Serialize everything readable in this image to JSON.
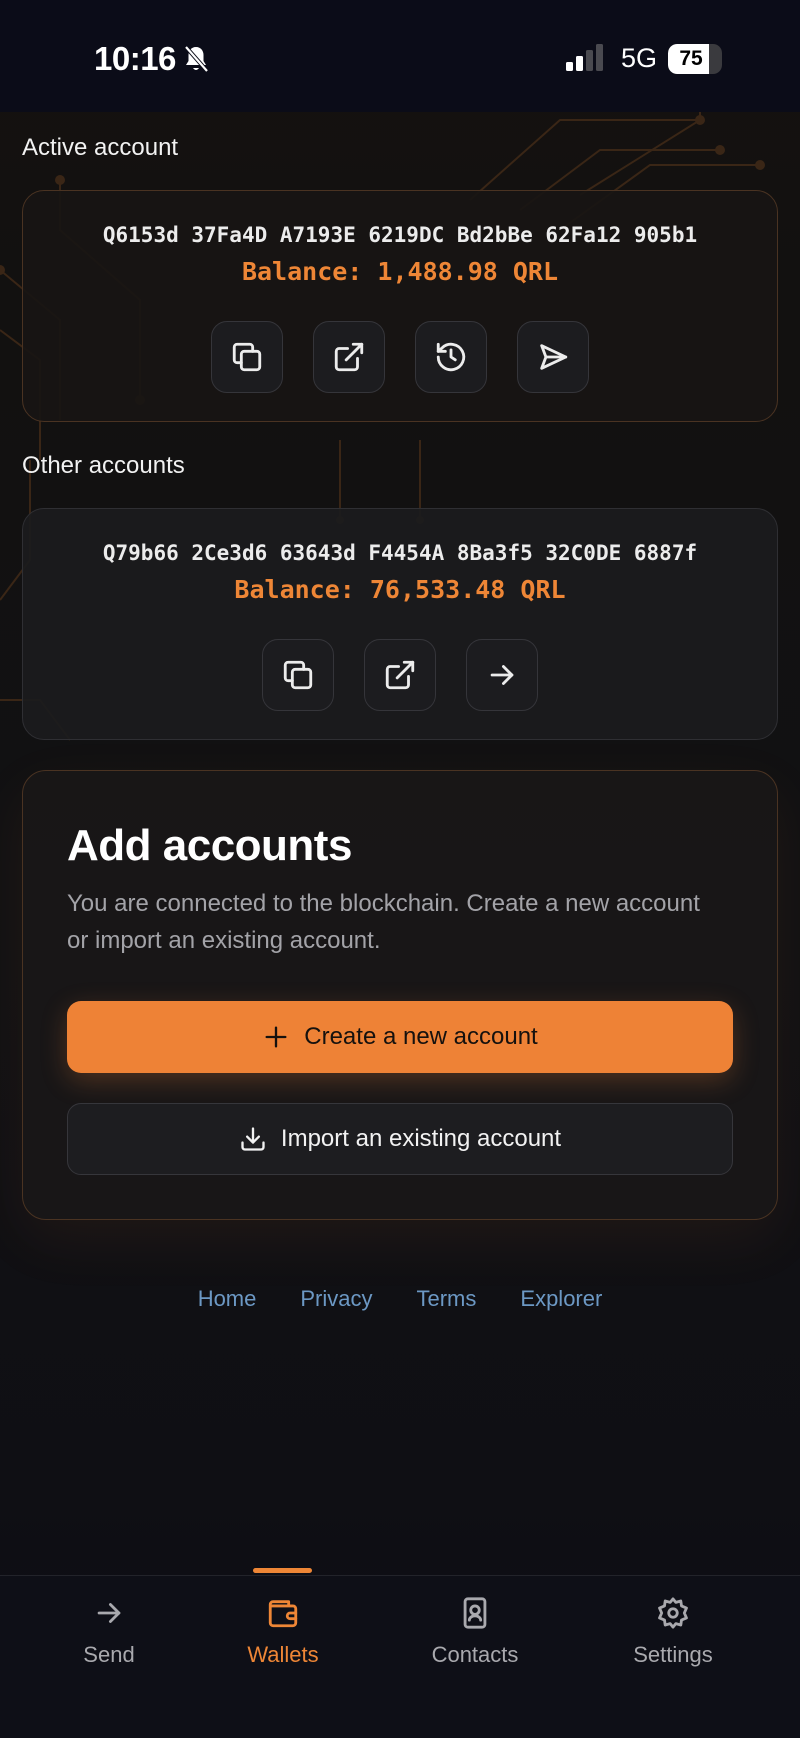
{
  "status_bar": {
    "time": "10:16",
    "network": "5G",
    "battery_percent": 75,
    "battery_label": "75",
    "signal_bars_active": 2,
    "signal_bars_total": 4
  },
  "colors": {
    "accent": "#ee8636",
    "link": "#6c98c4",
    "background": "#0b0c16"
  },
  "active_section": {
    "label": "Active account",
    "account": {
      "address": "Q6153d 37Fa4D A7193E 6219DC Bd2bBe 62Fa12 905b1",
      "balance": "Balance: 1,488.98 QRL",
      "actions": [
        {
          "icon": "copy-icon"
        },
        {
          "icon": "external-link-icon"
        },
        {
          "icon": "history-icon"
        },
        {
          "icon": "send-icon"
        }
      ]
    }
  },
  "other_section": {
    "label": "Other accounts",
    "accounts": [
      {
        "address": "Q79b66 2Ce3d6 63643d F4454A 8Ba3f5 32C0DE 6887f",
        "balance": "Balance: 76,533.48 QRL",
        "actions": [
          {
            "icon": "copy-icon"
          },
          {
            "icon": "external-link-icon"
          },
          {
            "icon": "arrow-right-icon"
          }
        ]
      }
    ]
  },
  "add_accounts": {
    "title": "Add accounts",
    "description": "You are connected to the blockchain. Create a new account or import an existing account.",
    "create_label": "Create a new account",
    "import_label": "Import an existing account"
  },
  "footer": {
    "links": [
      "Home",
      "Privacy",
      "Terms",
      "Explorer"
    ]
  },
  "tabs": [
    {
      "label": "Send",
      "icon": "arrow-right-icon",
      "selected": false
    },
    {
      "label": "Wallets",
      "icon": "wallet-icon",
      "selected": true
    },
    {
      "label": "Contacts",
      "icon": "contact-book-icon",
      "selected": false
    },
    {
      "label": "Settings",
      "icon": "gear-icon",
      "selected": false
    }
  ]
}
